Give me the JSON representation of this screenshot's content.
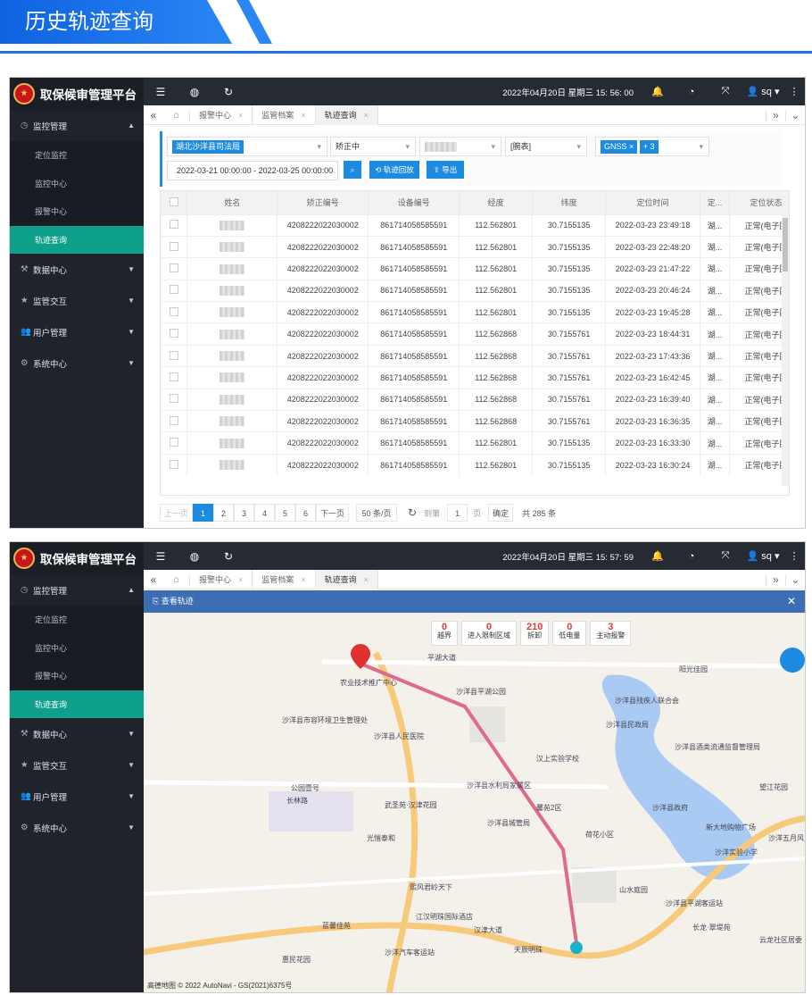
{
  "banner_title": "历史轨迹查询",
  "app": {
    "name": "取保候审管理平台",
    "user": "sq"
  },
  "menu": {
    "monitor": "监控管理",
    "items": [
      "定位监控",
      "监控中心",
      "报警中心",
      "轨迹查询"
    ],
    "data_center": "数据中心",
    "interaction": "监管交互",
    "users": "用户管理",
    "system": "系统中心"
  },
  "screen1": {
    "clock": "2022年04月20日 星期三 15: 56: 00",
    "tabs": [
      "报警中心",
      "监管档案",
      "轨迹查询"
    ],
    "filters": {
      "org": "湖北沙洋县司法局",
      "type": "矫正中",
      "report": "[腕表]",
      "gnss": "GNSS",
      "gnss_more": "+ 3",
      "date_range": "2022-03-21 00:00:00 - 2022-03-25 00:00:00",
      "replay": "轨迹回放",
      "export": "导出"
    },
    "columns": [
      "姓名",
      "矫正编号",
      "设备编号",
      "经度",
      "纬度",
      "定位时间",
      "定...",
      "定位状态"
    ],
    "rows": [
      [
        "4208222022030002",
        "861714058585591",
        "112.562801",
        "30.7155135",
        "2022-03-23 23:49:18",
        "湖...",
        "正常(电子围"
      ],
      [
        "4208222022030002",
        "861714058585591",
        "112.562801",
        "30.7155135",
        "2022-03-23 22:48:20",
        "湖...",
        "正常(电子围"
      ],
      [
        "4208222022030002",
        "861714058585591",
        "112.562801",
        "30.7155135",
        "2022-03-23 21:47:22",
        "湖...",
        "正常(电子围"
      ],
      [
        "4208222022030002",
        "861714058585591",
        "112.562801",
        "30.7155135",
        "2022-03-23 20:46:24",
        "湖...",
        "正常(电子围"
      ],
      [
        "4208222022030002",
        "861714058585591",
        "112.562801",
        "30.7155135",
        "2022-03-23 19:45:28",
        "湖...",
        "正常(电子围"
      ],
      [
        "4208222022030002",
        "861714058585591",
        "112.562868",
        "30.7155761",
        "2022-03-23 18:44:31",
        "湖...",
        "正常(电子围"
      ],
      [
        "4208222022030002",
        "861714058585591",
        "112.562868",
        "30.7155761",
        "2022-03-23 17:43:36",
        "湖...",
        "正常(电子围"
      ],
      [
        "4208222022030002",
        "861714058585591",
        "112.562868",
        "30.7155761",
        "2022-03-23 16:42:45",
        "湖...",
        "正常(电子围"
      ],
      [
        "4208222022030002",
        "861714058585591",
        "112.562868",
        "30.7155761",
        "2022-03-23 16:39:40",
        "湖...",
        "正常(电子围"
      ],
      [
        "4208222022030002",
        "861714058585591",
        "112.562868",
        "30.7155761",
        "2022-03-23 16:36:35",
        "湖...",
        "正常(电子围"
      ],
      [
        "4208222022030002",
        "861714058585591",
        "112.562801",
        "30.7155135",
        "2022-03-23 16:33:30",
        "湖...",
        "正常(电子围"
      ],
      [
        "4208222022030002",
        "861714058585591",
        "112.562801",
        "30.7155135",
        "2022-03-23 16:30:24",
        "湖...",
        "正常(电子围"
      ]
    ],
    "pager": {
      "prev": "上一页",
      "pages": [
        "1",
        "2",
        "3",
        "4",
        "5",
        "6"
      ],
      "next": "下一页",
      "size": "50 条/页",
      "goto": "到第",
      "page": "1",
      "page_unit": "页",
      "confirm": "确定",
      "total": "共 285 条"
    }
  },
  "screen2": {
    "clock": "2022年04月20日 星期三 15: 57: 59",
    "tabs": [
      "报警中心",
      "监管档案",
      "轨迹查询"
    ],
    "panel_title": "查看轨迹",
    "stats": [
      {
        "value": "0",
        "label": "越界"
      },
      {
        "value": "0",
        "label": "进入限制区域"
      },
      {
        "value": "210",
        "label": "拆卸"
      },
      {
        "value": "0",
        "label": "低电量"
      },
      {
        "value": "3",
        "label": "主动报警"
      }
    ],
    "places": [
      "农业技术推广中心",
      "平湖大道",
      "沙洋县平湖公园",
      "沙洋县残疾人联合会",
      "阳光佳园",
      "沙洋县市容环境卫生管理处",
      "沙洋县人民医院",
      "沙洋县民政局",
      "沙洋县酒类流通监督管理局",
      "汉上实验学校",
      "望江花园",
      "沙洋县水利局家属区",
      "沙洋县政府",
      "武圣苑·汉津花园",
      "沙洋县城管局",
      "新大地购物广场",
      "光愷泰和",
      "荷花小区",
      "沙洋五月风电竞酒店",
      "沙洋实验小学",
      "山水庭园",
      "沙洋县平湖客运站",
      "蓝馨佳苑",
      "江汉明珠国际酒店",
      "汉津大道",
      "长龙·翠堤苑",
      "惠民花园",
      "沙洋汽车客运站",
      "云龙社区居委",
      "公园壹号",
      "长林路",
      "馨苑2区",
      "熙风君岭天下",
      "天辰明珠"
    ],
    "copyright": "高德地图 © 2022 AutoNavi - GS(2021)6375号"
  }
}
